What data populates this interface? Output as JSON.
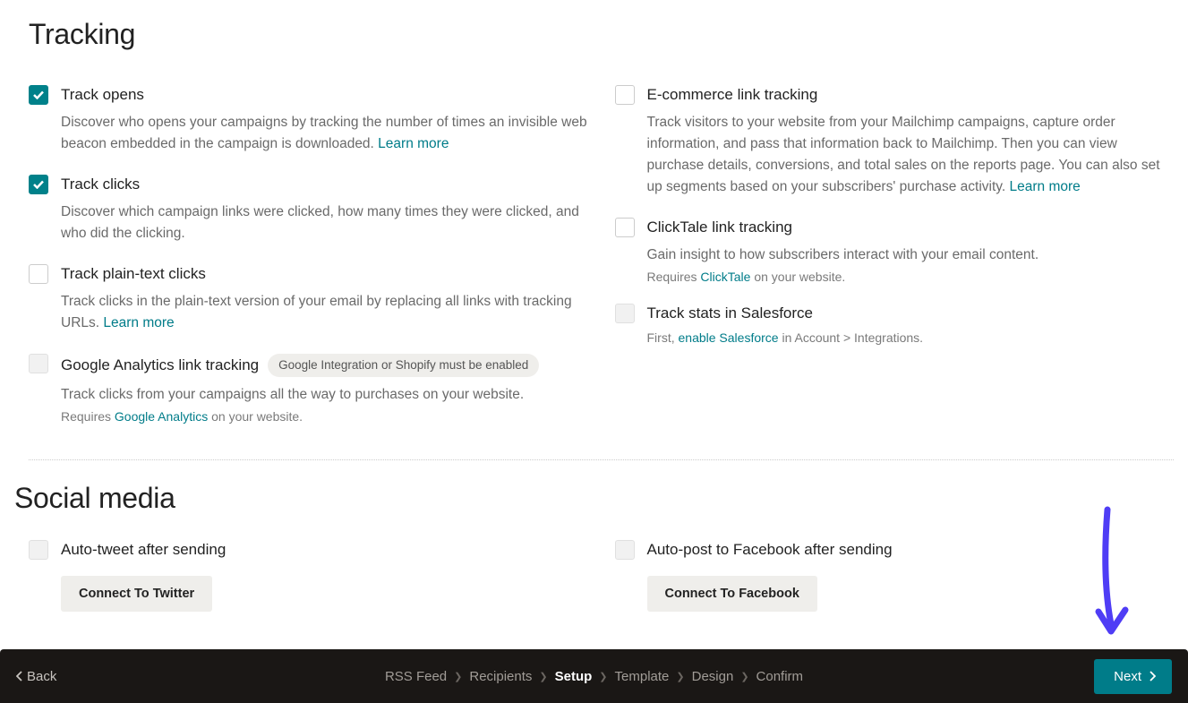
{
  "headings": {
    "tracking": "Tracking",
    "social": "Social media"
  },
  "tracking": {
    "left": {
      "opens": {
        "title": "Track opens",
        "desc": "Discover who opens your campaigns by tracking the number of times an invisible web beacon embedded in the campaign is downloaded. ",
        "learn": "Learn more"
      },
      "clicks": {
        "title": "Track clicks",
        "desc": "Discover which campaign links were clicked, how many times they were clicked, and who did the clicking."
      },
      "plain": {
        "title": "Track plain-text clicks",
        "desc": "Track clicks in the plain-text version of your email by replacing all links with tracking URLs. ",
        "learn": "Learn more"
      },
      "ga": {
        "title": "Google Analytics link tracking",
        "badge": "Google Integration or Shopify must be enabled",
        "desc": "Track clicks from your campaigns all the way to purchases on your website.",
        "note_prefix": "Requires ",
        "note_link": "Google Analytics",
        "note_suffix": " on your website."
      }
    },
    "right": {
      "ecom": {
        "title": "E-commerce link tracking",
        "desc": "Track visitors to your website from your Mailchimp campaigns, capture order information, and pass that information back to Mailchimp. Then you can view purchase details, conversions, and total sales on the reports page. You can also set up segments based on your subscribers' purchase activity. ",
        "learn": "Learn more"
      },
      "clicktale": {
        "title": "ClickTale link tracking",
        "desc": "Gain insight to how subscribers interact with your email content.",
        "note_prefix": "Requires ",
        "note_link": "ClickTale",
        "note_suffix": " on your website."
      },
      "salesforce": {
        "title": "Track stats in Salesforce",
        "note_prefix": "First, ",
        "note_link": "enable Salesforce",
        "note_suffix": " in Account > Integrations."
      }
    }
  },
  "social": {
    "twitter": {
      "title": "Auto-tweet after sending",
      "button": "Connect To Twitter"
    },
    "facebook": {
      "title": "Auto-post to Facebook after sending",
      "button": "Connect To Facebook"
    }
  },
  "footer": {
    "back": "Back",
    "steps": [
      "RSS Feed",
      "Recipients",
      "Setup",
      "Template",
      "Design",
      "Confirm"
    ],
    "active_index": 2,
    "next": "Next"
  },
  "colors": {
    "accent": "#007c89",
    "footer_bg": "#1a1715",
    "annotation": "#4f3df5"
  }
}
